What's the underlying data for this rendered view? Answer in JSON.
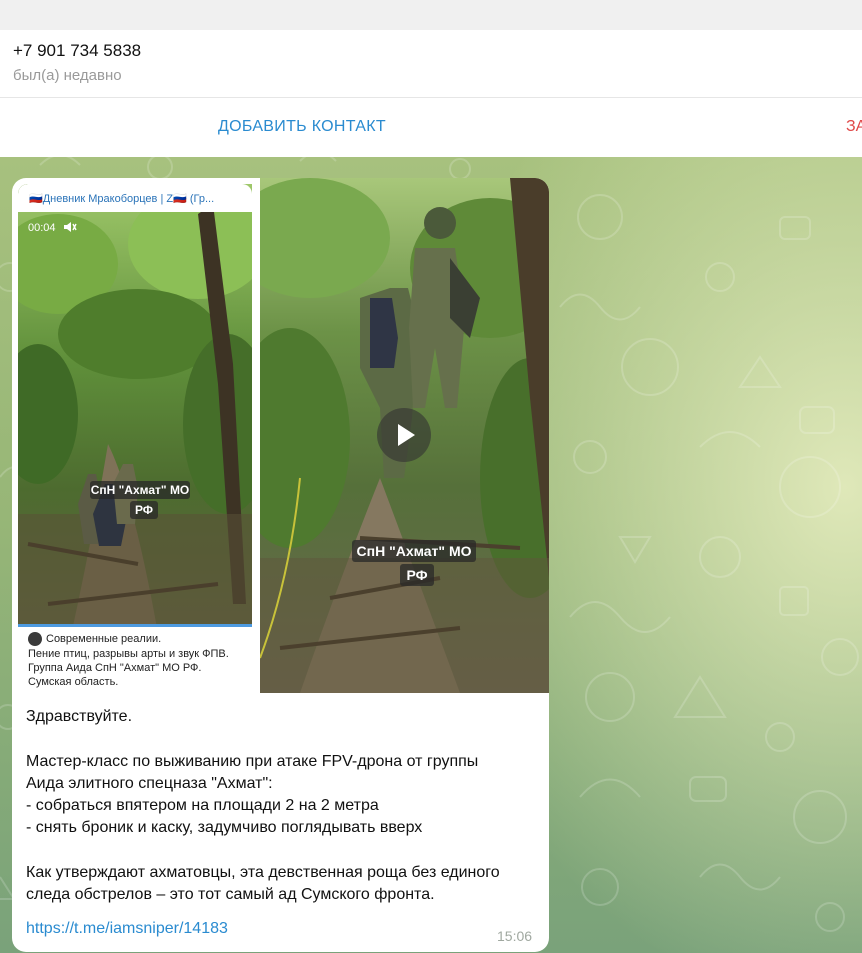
{
  "contact": {
    "phone": "+7 901 734 5838",
    "status": "был(а) недавно"
  },
  "actions": {
    "add_contact": "ДОБАВИТЬ КОНТАКТ",
    "block_contact": "ЗА"
  },
  "message": {
    "media": {
      "left_video": {
        "repost_channel": "🇷🇺Дневник Мракоборцев | Z🇷🇺 (Гр...",
        "timer": "00:04",
        "watermark_line1": "СпН \"Ахмат\" МО",
        "watermark_line2": "РФ",
        "progress_fraction": 1.0,
        "caption_channel": "Современные реалии.",
        "caption_lines": [
          "Пение птиц, разрывы арты и звук ФПВ.",
          "Группа Аида СпН \"Ахмат\" МО РФ.",
          "Сумская область."
        ]
      },
      "right_video": {
        "watermark_line1": "СпН \"Ахмат\" МО",
        "watermark_line2": "РФ"
      }
    },
    "text_lines": [
      "Здравствуйте.",
      "",
      "Мастер-класс по выживанию при атаке FPV-дрона от группы",
      "Аида элитного спецназа \"Ахмат\":",
      "- собраться впятером на площади 2 на 2 метра",
      "- снять броник и каску, задумчиво поглядывать вверх",
      "",
      "Как утверждают ахматовцы, эта девственная роща без единого",
      "следа обстрелов – это тот самый ад Сумского фронта."
    ],
    "link": "https://t.me/iamsniper/14183",
    "time": "15:06"
  },
  "colors": {
    "accent": "#2a8bd0",
    "danger": "#e04848",
    "chat_bg": "#97b677",
    "bubble": "#ffffff"
  },
  "icons": [
    "volume-icon",
    "play-icon",
    "channel-avatar-icon"
  ]
}
